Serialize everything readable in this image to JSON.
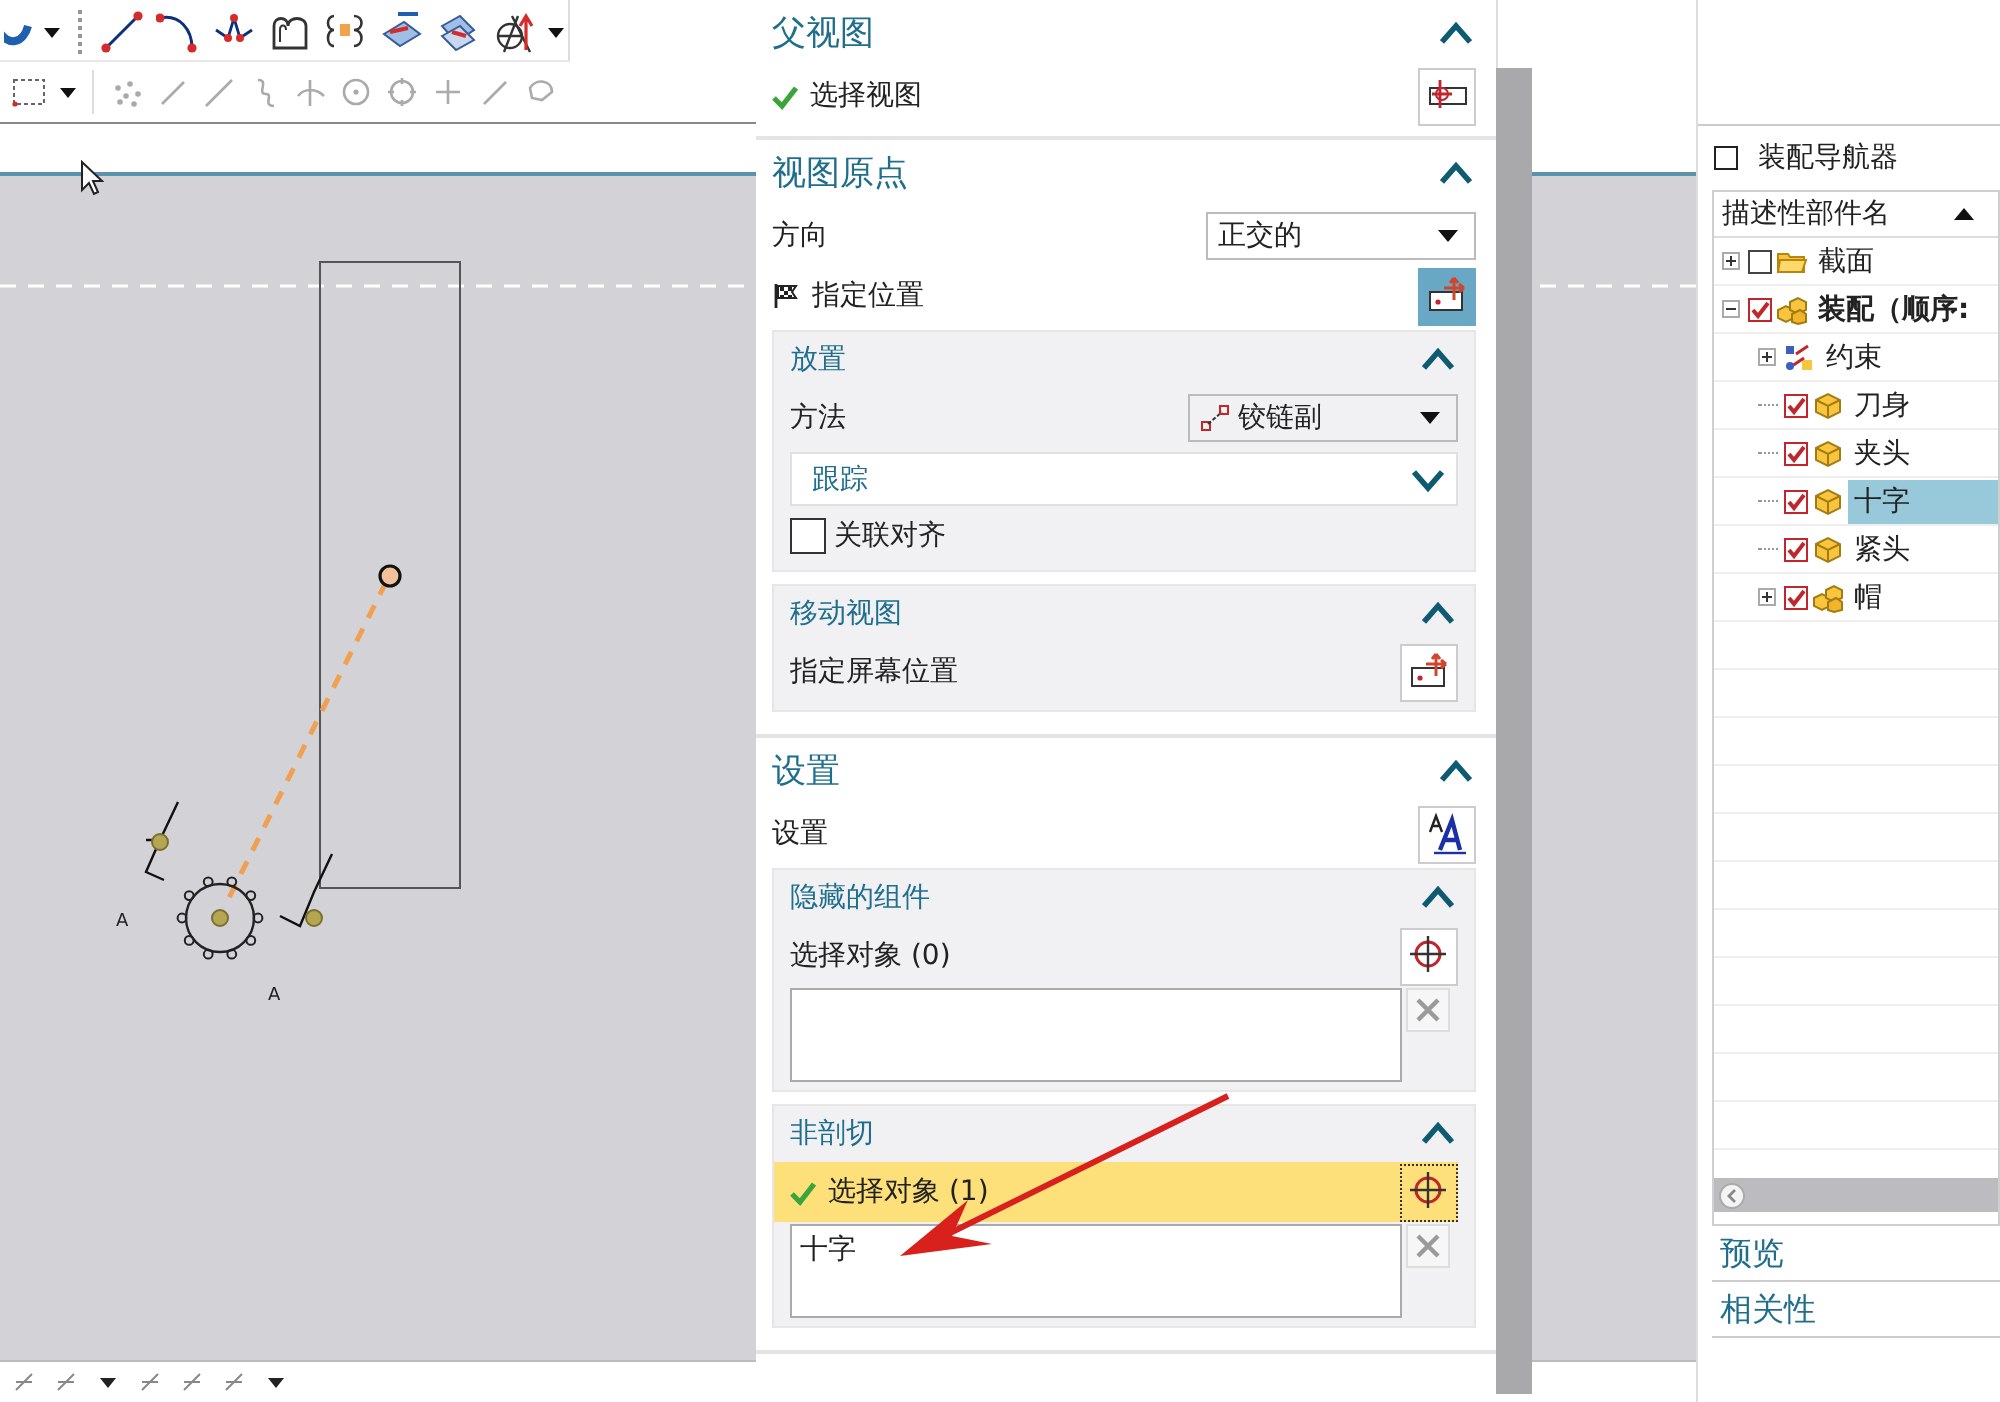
{
  "canvas": {
    "labels": [
      "A",
      "A"
    ]
  },
  "dialog": {
    "sections": [
      {
        "title": "父视图",
        "expanded": true,
        "rows": [
          {
            "kind": "select",
            "label": "选择视图",
            "checked": true,
            "active": false
          }
        ]
      },
      {
        "title": "视图原点",
        "expanded": true,
        "rows": [
          {
            "kind": "dropdown",
            "label": "方向",
            "value": "正交的"
          },
          {
            "kind": "select",
            "label": "指定位置",
            "required": true,
            "active": true
          },
          {
            "kind": "subgroup",
            "title": "放置",
            "expanded": true,
            "rows": [
              {
                "kind": "dropdown",
                "label": "方法",
                "value": "铰链副"
              },
              {
                "kind": "subgroup",
                "title": "跟踪",
                "expanded": false
              },
              {
                "kind": "checkbox",
                "label": "关联对齐",
                "checked": false
              }
            ]
          },
          {
            "kind": "subgroup",
            "title": "移动视图",
            "expanded": true,
            "rows": [
              {
                "kind": "select",
                "label": "指定屏幕位置",
                "active": false
              }
            ]
          }
        ]
      },
      {
        "title": "设置",
        "expanded": true,
        "rows": [
          {
            "kind": "select",
            "label": "设置",
            "active": false
          },
          {
            "kind": "subgroup",
            "title": "隐藏的组件",
            "expanded": true,
            "rows": [
              {
                "kind": "select",
                "label": "选择对象 (0)",
                "active": false,
                "highlighted": false
              },
              {
                "kind": "list"
              }
            ]
          },
          {
            "kind": "subgroup",
            "title": "非剖切",
            "expanded": true,
            "rows": [
              {
                "kind": "select",
                "label": "选择对象 (1)",
                "checked": true,
                "active": false,
                "highlighted": true
              },
              {
                "kind": "list",
                "items": [
                  "十字"
                ]
              }
            ]
          }
        ]
      }
    ]
  },
  "navigator": {
    "title": "装配导航器",
    "column": "描述性部件名",
    "sorted": true,
    "nodes": [
      {
        "label": "截面",
        "kind": "folder",
        "checked": false,
        "expanded": false,
        "selected": false
      },
      {
        "label": "装配（顺序:",
        "kind": "assembly",
        "checked": true,
        "expanded": true,
        "selected": false,
        "bold": true,
        "children": [
          {
            "label": "约束",
            "kind": "constraint",
            "expanded": false,
            "selected": false
          },
          {
            "label": "刀身",
            "kind": "part",
            "checked": true,
            "selected": false
          },
          {
            "label": "夹头",
            "kind": "part",
            "checked": true,
            "selected": false
          },
          {
            "label": "十字",
            "kind": "part",
            "checked": true,
            "selected": true
          },
          {
            "label": "紧头",
            "kind": "part",
            "checked": true,
            "selected": false
          },
          {
            "label": "帽",
            "kind": "assembly",
            "checked": true,
            "expanded": false,
            "selected": false
          }
        ]
      }
    ],
    "panels": [
      {
        "label": "预览"
      },
      {
        "label": "相关性"
      }
    ]
  }
}
